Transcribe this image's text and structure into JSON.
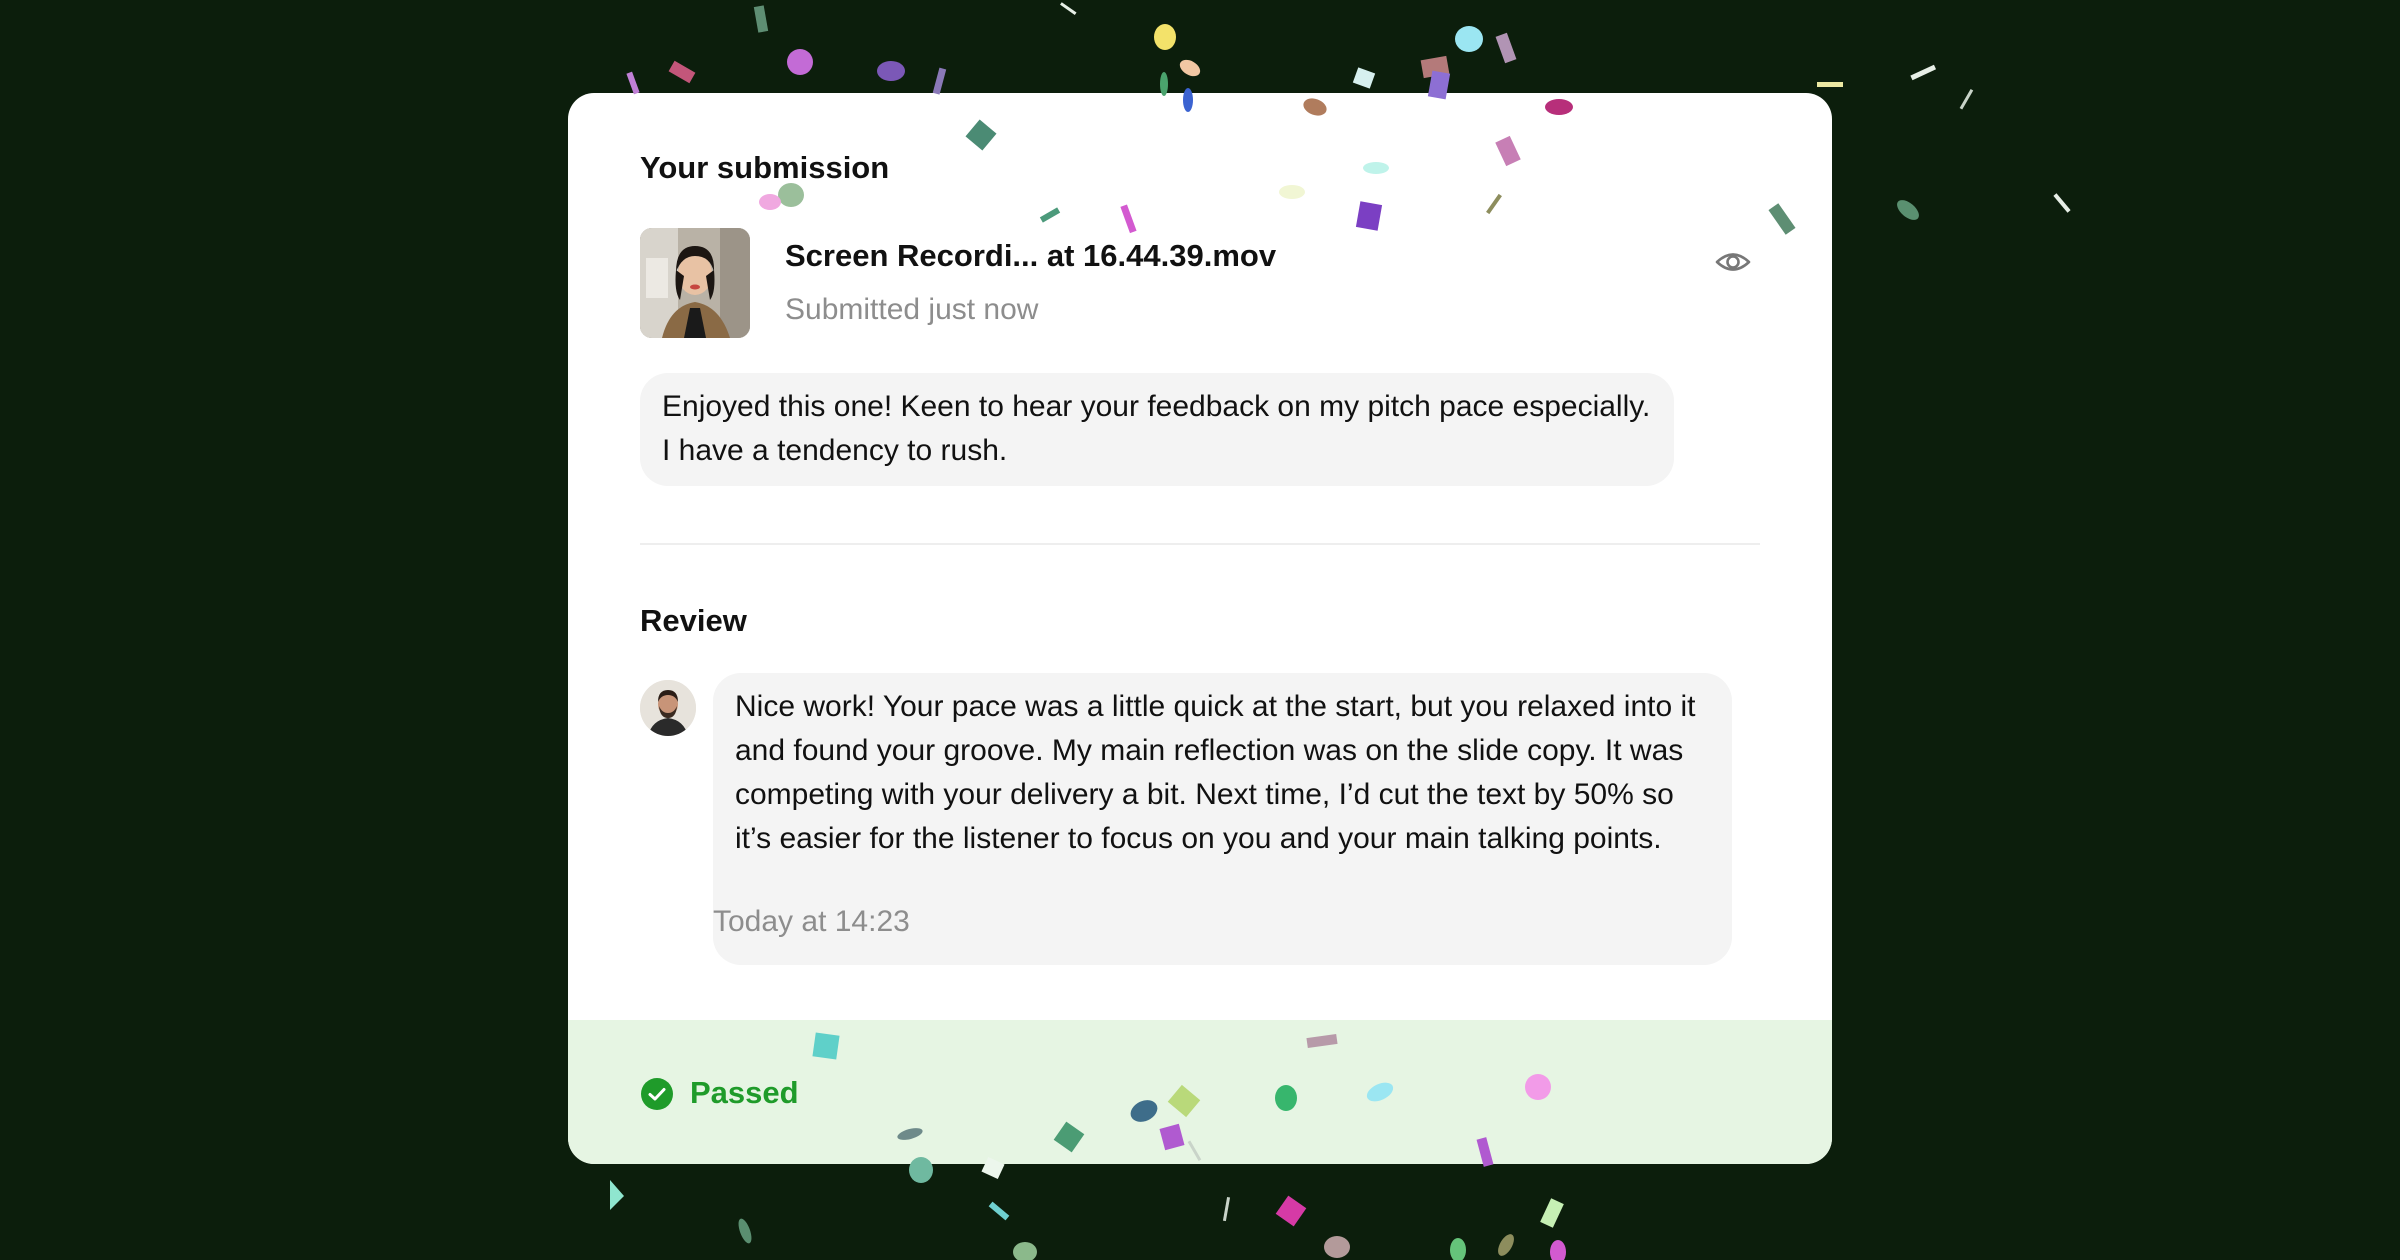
{
  "submission": {
    "heading": "Your submission",
    "file_name": "Screen Recordi... at 16.44.39.mov",
    "file_status": "Submitted just now",
    "thumbnail_icon": "video-thumbnail",
    "view_icon": "eye-icon",
    "comment_lines": [
      "Enjoyed this one! Keen to hear your feedback on my pitch pace especially.",
      "I have a tendency to rush."
    ]
  },
  "review": {
    "heading": "Review",
    "reviewer_avatar": "reviewer-avatar",
    "comment_lines": [
      "Nice work! Your pace was a little quick at the start, but you relaxed into it",
      "and found your groove. My main reflection was on the slide copy. It was",
      "competing with your delivery a bit. Next time, I’d cut the text by 50% so",
      "it’s easier for the listener to focus on you and your main talking points."
    ],
    "timestamp": "Today at 14:23"
  },
  "result": {
    "label": "Passed",
    "icon": "check-circle-icon",
    "color": "#1f9b2a"
  },
  "colors": {
    "background": "#0c1e0c",
    "card": "#ffffff",
    "footer": "#e6f5e3",
    "bubble": "#f4f4f4",
    "muted_text": "#8d8d8d"
  }
}
